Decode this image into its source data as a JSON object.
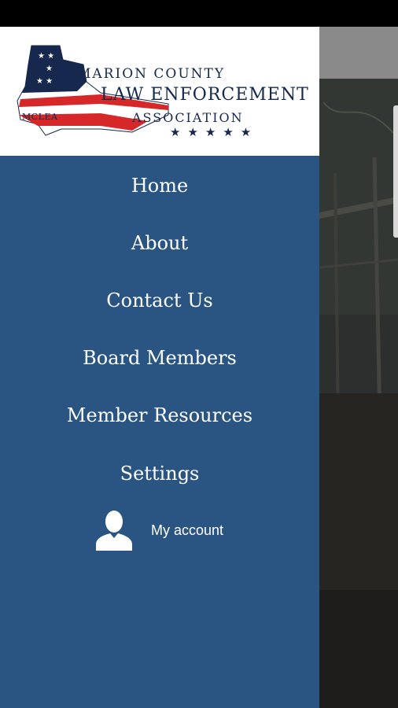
{
  "logo": {
    "line1": "MARION COUNTY",
    "line2": "LAW ENFORCEMENT",
    "line3": "ASSOCIATION",
    "abbr": "MCLEA",
    "stars": "★★★★★"
  },
  "menu": {
    "items": [
      {
        "label": "Home"
      },
      {
        "label": "About"
      },
      {
        "label": "Contact Us"
      },
      {
        "label": "Board Members"
      },
      {
        "label": "Member Resources"
      },
      {
        "label": "Settings"
      }
    ],
    "account_label": "My account"
  },
  "colors": {
    "drawer": "#2a5583",
    "logo_navy": "#16284d",
    "logo_red": "#d62828"
  }
}
